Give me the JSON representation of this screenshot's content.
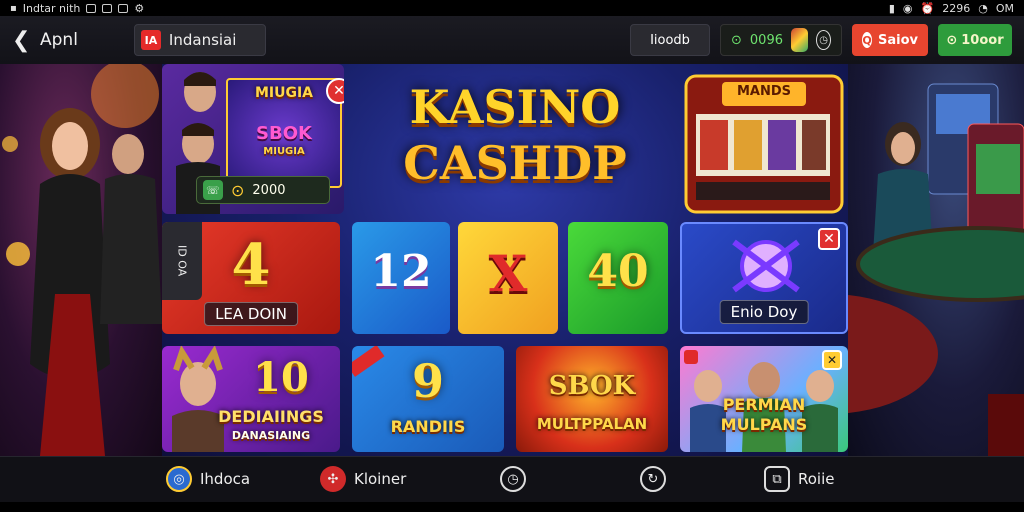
{
  "statusbar": {
    "left_text": "Indtar nith",
    "right_text": "2296",
    "right_extra": "OM"
  },
  "appbar": {
    "back_icon": "arrow-left-icon",
    "title": "Apnl",
    "region_flag_text": "IA",
    "region_label": "Indansiai",
    "account_label": "Iioodb",
    "coins": "0096",
    "red_button": "Saiov",
    "green_button": "10oor"
  },
  "hero": {
    "promo_title": "MIUGIA",
    "promo_game": "SBOK",
    "promo_sub": "MIUGIA",
    "promo_amount": "2000",
    "logo_line1": "KASINO",
    "logo_line2": "CASHDP",
    "slot_label": "MANDS"
  },
  "tiles": [
    {
      "number": "4",
      "caption": "LEA DOIN",
      "side": "ID OA"
    },
    {
      "number": "12"
    },
    {
      "number": "X"
    },
    {
      "number": "40"
    },
    {
      "caption": "Enio Doy"
    }
  ],
  "games": [
    {
      "number": "10",
      "title": "DEDIAIINGS",
      "sub": "DANASIAING"
    },
    {
      "number": "9",
      "title": "RANDIIS"
    },
    {
      "title": "SBOK",
      "sub": "MULTPPALAN"
    },
    {
      "title": "PERMIAN",
      "sub": "MULPANS"
    }
  ],
  "nav": [
    {
      "label": "Ihdoca",
      "icon": "globe-icon"
    },
    {
      "label": "Kloiner",
      "icon": "roulette-icon"
    },
    {
      "label": "",
      "icon": "clock-icon"
    },
    {
      "label": "",
      "icon": "refresh-icon"
    },
    {
      "label": "Roiie",
      "icon": "puzzle-icon"
    }
  ],
  "colors": {
    "red": "#e7452f",
    "green": "#2e9c3c",
    "gold": "#ffd84a",
    "navy": "#18206a"
  }
}
